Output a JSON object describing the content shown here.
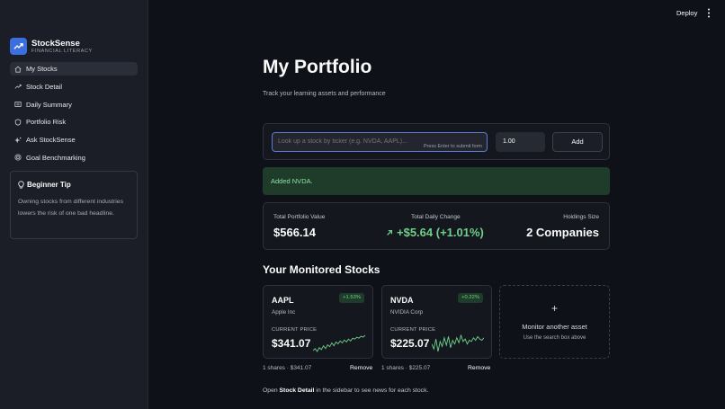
{
  "app": {
    "name": "StockSense",
    "tagline": "FINANCIAL LITERACY",
    "accent_color": "#3b6fe0",
    "logo_icon": "trend-up-icon"
  },
  "header": {
    "deploy_label": "Deploy",
    "menu_icon": "more-vertical-icon"
  },
  "sidebar": {
    "items": [
      {
        "label": "My Stocks",
        "icon": "home-icon",
        "active": true
      },
      {
        "label": "Stock Detail",
        "icon": "trend-line-icon"
      },
      {
        "label": "Daily Summary",
        "icon": "newspaper-icon"
      },
      {
        "label": "Portfolio Risk",
        "icon": "shield-icon"
      },
      {
        "label": "Ask StockSense",
        "icon": "sparkles-icon"
      },
      {
        "label": "Goal Benchmarking",
        "icon": "target-icon"
      }
    ],
    "tip": {
      "icon": "lightbulb-icon",
      "title": "Beginner Tip",
      "text": "Owning stocks from different industries lowers the risk of one bad headline."
    }
  },
  "main": {
    "title": "My Portfolio",
    "subtitle": "Track your learning assets and performance",
    "form": {
      "search_placeholder": "Look up a stock by ticker (e.g. NVDA, AAPL)...",
      "search_hint": "Press Enter to submit form",
      "quantity": "1.00",
      "add_label": "Add"
    },
    "success_message": "Added NVDA.",
    "summary": {
      "total_value_label": "Total Portfolio Value",
      "total_value": "$566.14",
      "daily_change_label": "Total Daily Change",
      "daily_change": "+$5.64 (+1.01%)",
      "holdings_label": "Holdings Size",
      "holdings": "2 Companies"
    },
    "section_title": "Your Monitored Stocks",
    "stocks": [
      {
        "ticker": "AAPL",
        "name": "Apple Inc",
        "change_badge": "+1.53%",
        "price_label": "CURRENT PRICE",
        "price": "$341.07",
        "footer": "1 shares · $341.07",
        "remove_label": "Remove",
        "sparkline": [
          3,
          5,
          2,
          6,
          4,
          8,
          5,
          9,
          7,
          11,
          8,
          12,
          10,
          13,
          11,
          14,
          12,
          15,
          13,
          16,
          15,
          17,
          16,
          18,
          17,
          19
        ]
      },
      {
        "ticker": "NVDA",
        "name": "NVIDIA Corp",
        "change_badge": "+0.22%",
        "price_label": "CURRENT PRICE",
        "price": "$225.07",
        "footer": "1 shares · $225.07",
        "remove_label": "Remove",
        "sparkline": [
          10,
          6,
          14,
          4,
          12,
          8,
          15,
          9,
          16,
          7,
          13,
          10,
          15,
          11,
          17,
          12,
          14,
          10,
          13,
          12,
          15,
          13,
          16,
          14,
          13,
          15
        ]
      }
    ],
    "add_card": {
      "plus": "+",
      "title": "Monitor another asset",
      "subtitle": "Use the search box above"
    },
    "footer_note": {
      "prefix": "Open ",
      "bold": "Stock Detail",
      "suffix": " in the sidebar to see news for each stock."
    },
    "positive_color": "#6fd08a"
  }
}
